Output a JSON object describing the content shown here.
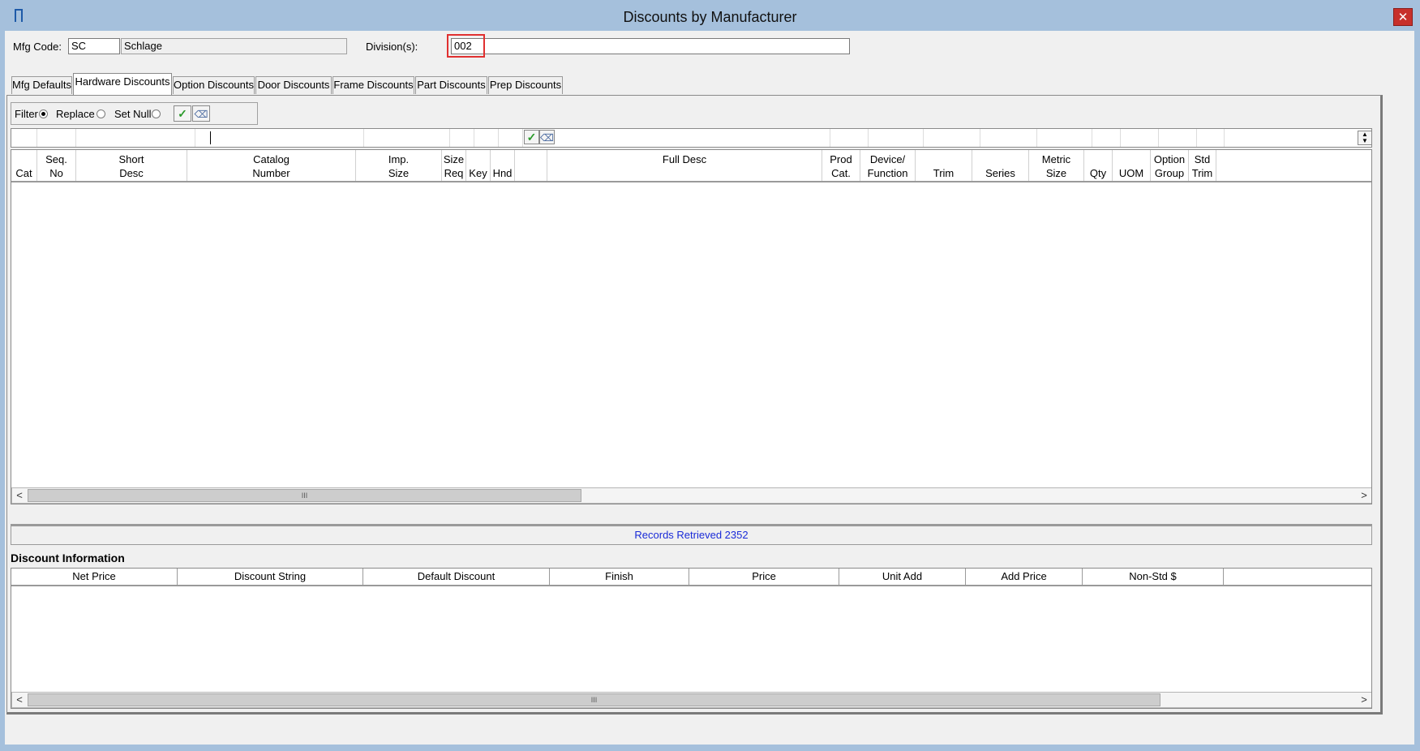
{
  "window": {
    "title": "Discounts by Manufacturer",
    "close_label": "✕"
  },
  "header": {
    "mfg_code_label": "Mfg Code:",
    "mfg_code_value": "SC",
    "mfg_name_value": "Schlage",
    "divisions_label": "Division(s):",
    "divisions_value": "002"
  },
  "tabs": [
    {
      "label": "Mfg Defaults",
      "active": false
    },
    {
      "label": "Hardware Discounts",
      "active": true
    },
    {
      "label": "Option Discounts",
      "active": false
    },
    {
      "label": "Door Discounts",
      "active": false
    },
    {
      "label": "Frame Discounts",
      "active": false
    },
    {
      "label": "Part Discounts",
      "active": false
    },
    {
      "label": "Prep Discounts",
      "active": false
    }
  ],
  "filter_options": {
    "filter_label": "Filter",
    "replace_label": "Replace",
    "set_null_label": "Set Null",
    "selected": "Filter"
  },
  "grid": {
    "columns": [
      {
        "line1": "",
        "line2": "Cat"
      },
      {
        "line1": "Seq.",
        "line2": "No"
      },
      {
        "line1": "Short",
        "line2": "Desc"
      },
      {
        "line1": "Catalog",
        "line2": "Number"
      },
      {
        "line1": "Imp.",
        "line2": "Size"
      },
      {
        "line1": "Size",
        "line2": "Req"
      },
      {
        "line1": "",
        "line2": "Key"
      },
      {
        "line1": "",
        "line2": "Hnd"
      },
      {
        "line1": "",
        "line2": ""
      },
      {
        "line1": "Full Desc",
        "line2": ""
      },
      {
        "line1": "Prod",
        "line2": "Cat."
      },
      {
        "line1": "Device/",
        "line2": "Function"
      },
      {
        "line1": "",
        "line2": "Trim"
      },
      {
        "line1": "",
        "line2": "Series"
      },
      {
        "line1": "Metric",
        "line2": "Size"
      },
      {
        "line1": "",
        "line2": "Qty"
      },
      {
        "line1": "",
        "line2": "UOM"
      },
      {
        "line1": "Option",
        "line2": "Group"
      },
      {
        "line1": "Std",
        "line2": "Trim"
      }
    ],
    "rows": []
  },
  "status": {
    "records_text": "Records Retrieved 2352"
  },
  "discount_info": {
    "title": "Discount Information",
    "columns": [
      "Net Price",
      "Discount String",
      "Default Discount",
      "Finish",
      "Price",
      "Unit Add",
      "Add Price",
      "Non-Std $"
    ],
    "rows": []
  },
  "icons": {
    "apply": "check-icon",
    "clear": "eraser-icon"
  },
  "colors": {
    "titlebar": "#a5c0dc",
    "status_text": "#1a2bd8",
    "highlight": "#e03030"
  }
}
